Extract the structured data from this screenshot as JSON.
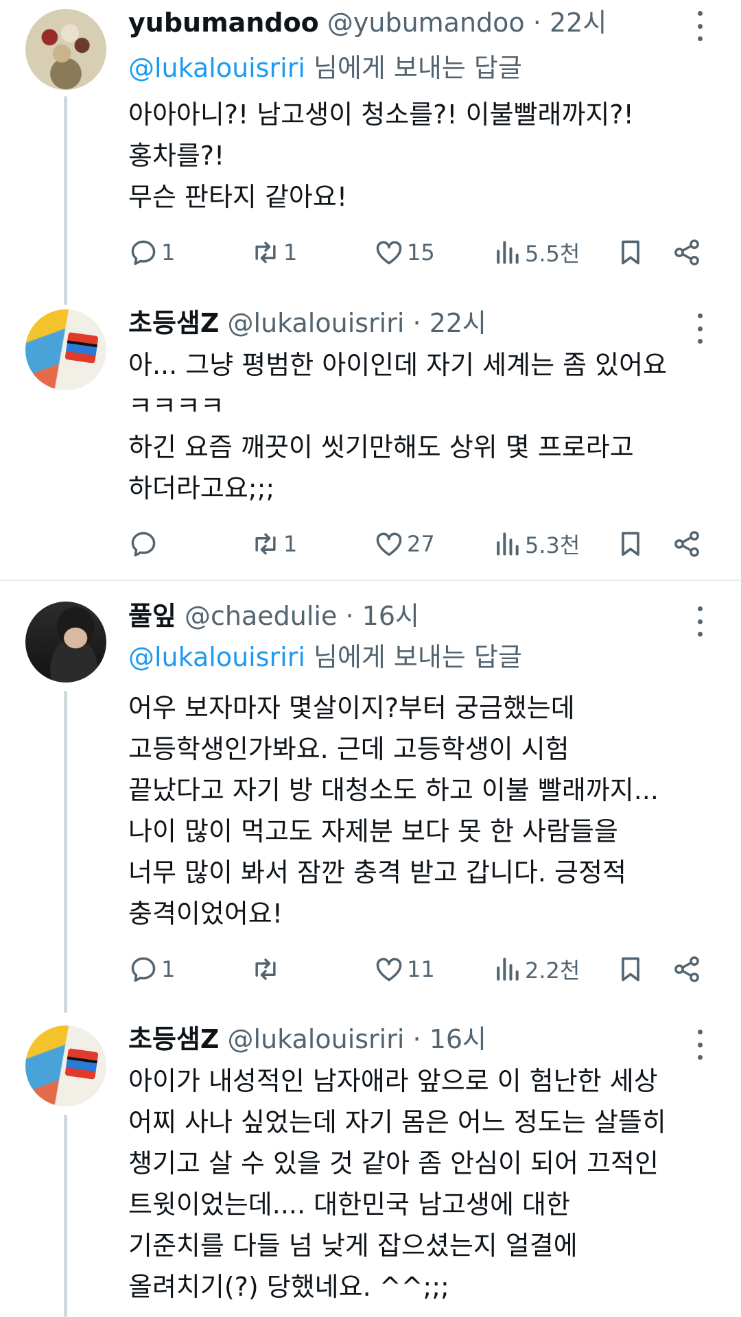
{
  "colors": {
    "text": "#0f1419",
    "secondary": "#536471",
    "accent": "#1d9bf0",
    "thread": "#cfd9de"
  },
  "tweets": [
    {
      "name": "yubumandoo",
      "handle": "@yubumandoo",
      "dot": "·",
      "time": "22시",
      "reply_mention": "@lukalouisriri",
      "reply_suffix": " 님에게 보내는 답글",
      "text": "아아아니?! 남고생이 청소를?! 이불빨래까지?!\n홍차를?!\n무슨 판타지 같아요!",
      "replies": "1",
      "retweets": "1",
      "likes": "15",
      "views": "5.5천",
      "avatar_icon": "flower-bouquet-avatar"
    },
    {
      "name": "초등샘Z",
      "handle": "@lukalouisriri",
      "dot": "·",
      "time": "22시",
      "text": "아... 그냥 평범한 아이인데 자기 세계는 좀 있어요\nㅋㅋㅋㅋ\n하긴 요즘 깨끗이 씻기만해도 상위 몇 프로라고\n하더라고요;;;",
      "replies": "",
      "retweets": "1",
      "likes": "27",
      "views": "5.3천",
      "avatar_icon": "book-cover-avatar"
    },
    {
      "name": "풀잎",
      "handle": "@chaedulie",
      "dot": "·",
      "time": "16시",
      "reply_mention": "@lukalouisriri",
      "reply_suffix": " 님에게 보내는 답글",
      "text": "어우 보자마자 몇살이지?부터 궁금했는데\n고등학생인가봐요. 근데 고등학생이 시험\n끝났다고 자기 방 대청소도 하고 이불 빨래까지...\n나이 많이 먹고도 자제분 보다 못 한 사람들을\n너무 많이 봐서 잠깐 충격 받고 갑니다. 긍정적\n충격이었어요!",
      "replies": "1",
      "retweets": "",
      "likes": "11",
      "views": "2.2천",
      "avatar_icon": "person-headphones-avatar"
    },
    {
      "name": "초등샘Z",
      "handle": "@lukalouisriri",
      "dot": "·",
      "time": "16시",
      "text": "아이가 내성적인 남자애라 앞으로 이 험난한 세상\n어찌 사나 싶었는데 자기 몸은 어느 정도는 살뜰히\n챙기고 살 수 있을 것 같아 좀 안심이 되어 끄적인\n트윗이었는데.... 대한민국 남고생에 대한\n기준치를 다들 넘 낮게 잡으셨는지 얼결에\n올려치기(?) 당했네요. ^^;;;",
      "avatar_icon": "book-cover-avatar"
    }
  ]
}
